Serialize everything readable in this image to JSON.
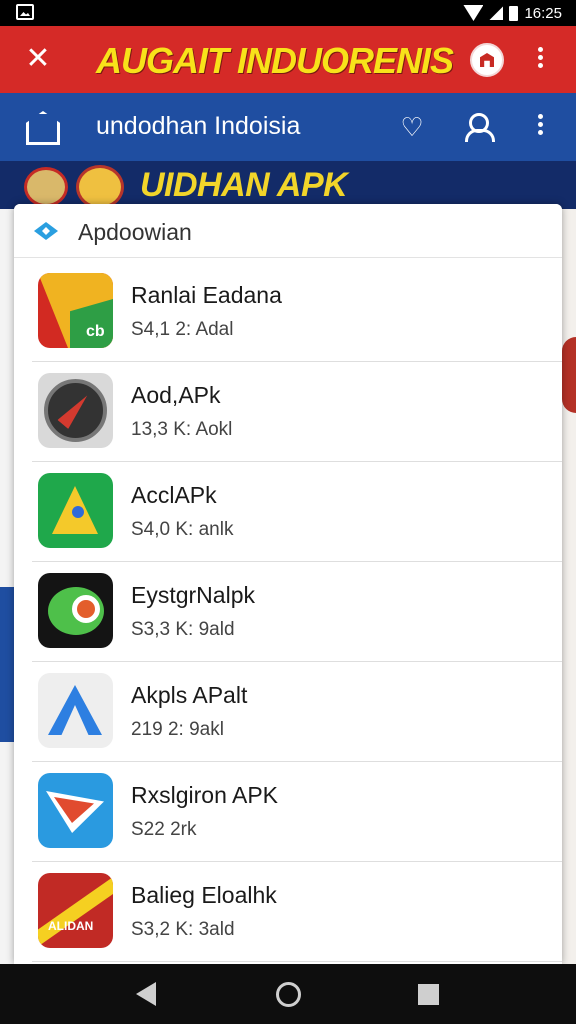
{
  "status_bar": {
    "time": "16:25"
  },
  "top_bar": {
    "title": "AUGAIT INDUORENIS"
  },
  "nav_header": {
    "title": "undodhan Indoisia"
  },
  "banner": {
    "title": "UIDHAN APK"
  },
  "sheet": {
    "title": "Apdoowian",
    "apps": [
      {
        "name": "Ranlai Eadana",
        "meta": "S4,1 2: Adal"
      },
      {
        "name": "Aod,APk",
        "meta": "13,3 K: Aokl"
      },
      {
        "name": "AcclAPk",
        "meta": "S4,0 K: anlk"
      },
      {
        "name": "EystgrNalpk",
        "meta": "S3,3 K: 9ald"
      },
      {
        "name": "Akpls APalt",
        "meta": "219 2: 9akl"
      },
      {
        "name": "Rxslgiron APK",
        "meta": "S22 2rk"
      },
      {
        "name": "Balieg Eloalhk",
        "meta": "S3,2 K: 3ald"
      }
    ]
  },
  "icons": {
    "close": "✕",
    "heart": "♡"
  },
  "app_icon_texts": {
    "app1": "cb",
    "app7": "ALIDAN"
  },
  "colors": {
    "red_bar": "#d52a27",
    "blue_bar": "#1f4ea1",
    "banner_bg": "#132b68",
    "banner_text": "#f2d52a"
  }
}
